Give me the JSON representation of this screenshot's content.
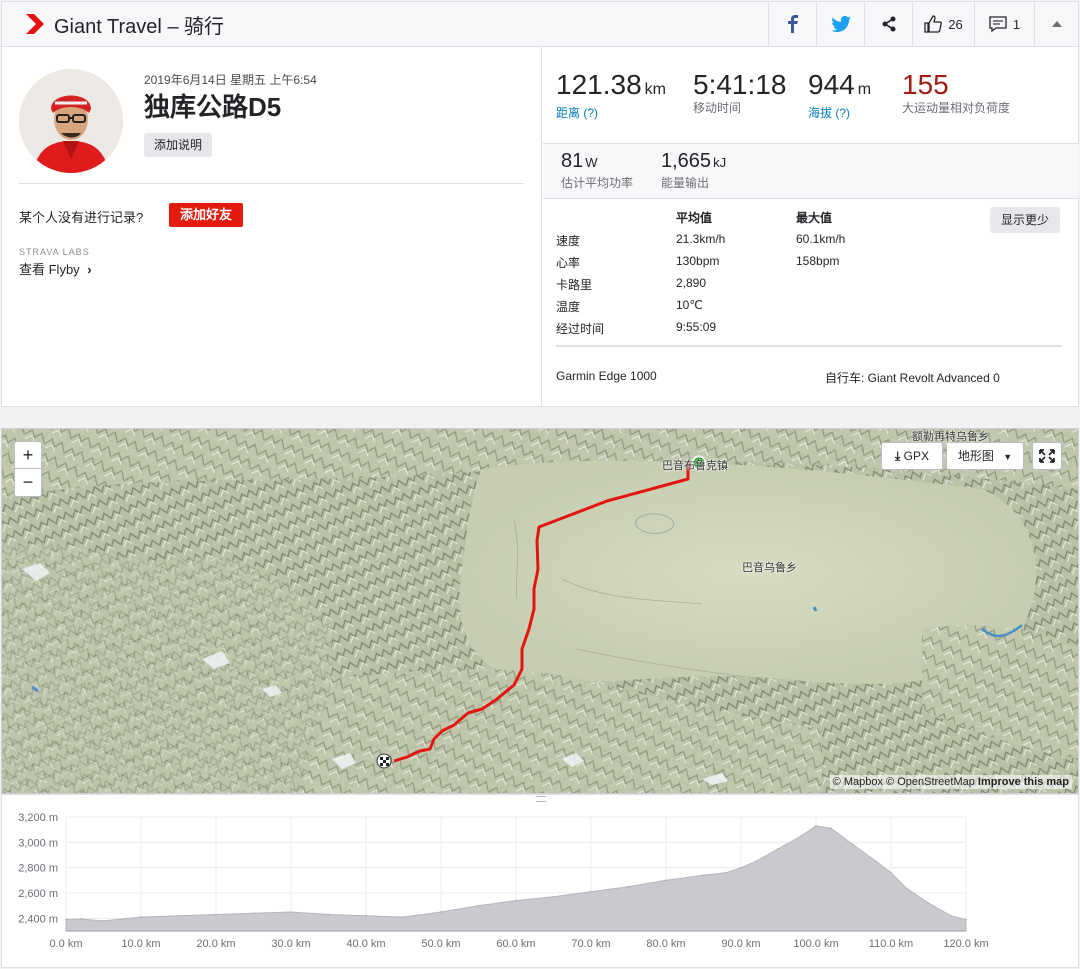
{
  "header": {
    "brand": "Giant Travel – 骑行",
    "kudos_count": "26",
    "comment_count": "1"
  },
  "athlete": {
    "date": "2019年6月14日 星期五 上午6:54",
    "activity_title": "独库公路D5",
    "add_description": "添加说明",
    "no_record_text": "某个人没有进行记录?",
    "add_friend": "添加好友",
    "labs_label": "STRAVA LABS",
    "flyby_link": "查看 Flyby"
  },
  "stats": {
    "distance": {
      "value": "121.38",
      "unit": "km",
      "label": "距离 (?)"
    },
    "moving_time": {
      "value": "5:41:18",
      "label": "移动时间"
    },
    "elevation": {
      "value": "944",
      "unit": "m",
      "label": "海拔 (?)"
    },
    "relative_effort": {
      "value": "155",
      "label": "大运动量相对负荷度"
    },
    "power": {
      "value": "81",
      "unit": "W",
      "label": "估计平均功率"
    },
    "energy": {
      "value": "1,665",
      "unit": "kJ",
      "label": "能量输出"
    }
  },
  "details": {
    "col_avg": "平均值",
    "col_max": "最大值",
    "show_less": "显示更少",
    "rows": [
      {
        "label": "速度",
        "avg": "21.3km/h",
        "max": "60.1km/h"
      },
      {
        "label": "心率",
        "avg": "130bpm",
        "max": "158bpm"
      },
      {
        "label": "卡路里",
        "avg": "2,890",
        "max": ""
      },
      {
        "label": "温度",
        "avg": "10℃",
        "max": ""
      },
      {
        "label": "经过时间",
        "avg": "9:55:09",
        "max": ""
      }
    ],
    "device": "Garmin Edge 1000",
    "bike": "自行车: Giant Revolt Advanced 0"
  },
  "map": {
    "zoom_in": "+",
    "zoom_out": "−",
    "gpx_label": "GPX",
    "terrain_label": "地形图",
    "places": [
      "额勒再特乌鲁乡",
      "巴音布鲁克镇",
      "巴音乌鲁乡"
    ],
    "credits_mapbox": "© Mapbox",
    "credits_osm": "© OpenStreetMap",
    "credits_improve": "Improve this map"
  },
  "colors": {
    "strava_orange": "#fc4c02",
    "route_red": "#e4150f",
    "relative_effort_red": "#a51b14",
    "link_blue": "#007fb6"
  },
  "chart_data": {
    "type": "area",
    "x_unit": "km",
    "y_unit": "m",
    "xlim": [
      0,
      120
    ],
    "ylim": [
      2300,
      3200
    ],
    "x_ticks": [
      "0.0 km",
      "10.0 km",
      "20.0 km",
      "30.0 km",
      "40.0 km",
      "50.0 km",
      "60.0 km",
      "70.0 km",
      "80.0 km",
      "90.0 km",
      "100.0 km",
      "110.0 km",
      "120.0 km"
    ],
    "y_ticks": [
      "2,400 m",
      "2,600 m",
      "2,800 m",
      "3,000 m",
      "3,200 m"
    ],
    "x": [
      0,
      2,
      5,
      10,
      15,
      20,
      25,
      30,
      35,
      40,
      45,
      50,
      55,
      60,
      65,
      70,
      75,
      80,
      85,
      88,
      90,
      92,
      95,
      98,
      100,
      102,
      105,
      108,
      110,
      112,
      115,
      118,
      120
    ],
    "y": [
      2390,
      2395,
      2380,
      2410,
      2420,
      2430,
      2440,
      2450,
      2430,
      2420,
      2410,
      2450,
      2500,
      2540,
      2570,
      2610,
      2650,
      2700,
      2740,
      2760,
      2800,
      2850,
      2950,
      3050,
      3130,
      3110,
      2980,
      2850,
      2760,
      2640,
      2520,
      2420,
      2390
    ]
  }
}
